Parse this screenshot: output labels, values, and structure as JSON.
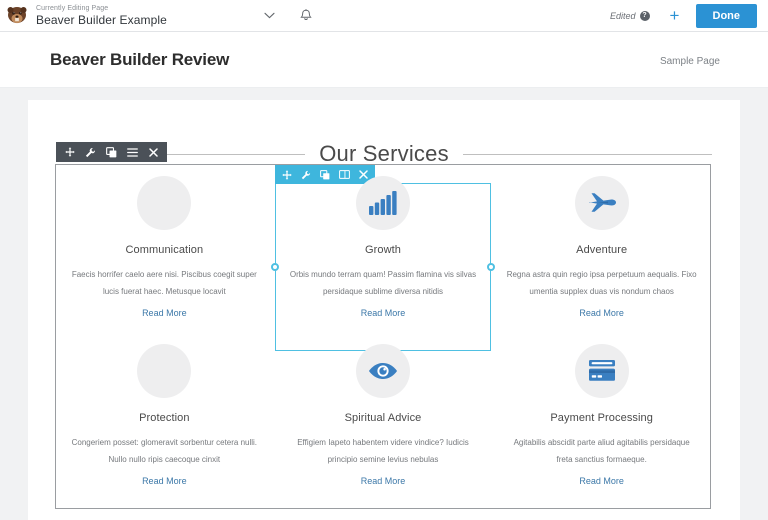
{
  "admin_bar": {
    "logo_icon": "beaver-logo-icon",
    "eyebrow": "Currently Editing Page",
    "title": "Beaver Builder Example",
    "caret_icon": "chevron-down-icon",
    "bell_icon": "bell-icon",
    "edited_label": "Edited",
    "help_icon": "help-question-icon",
    "plus_icon": "plus-icon",
    "done_label": "Done",
    "accent_color": "#2b92d4"
  },
  "site_header": {
    "title": "Beaver Builder Review",
    "nav": [
      {
        "label": "Sample Page"
      }
    ]
  },
  "page": {
    "section_heading": "Our Services"
  },
  "row_toolbar": {
    "background": "#4b5158",
    "buttons": [
      {
        "icon": "move-icon",
        "name": "row-move-button"
      },
      {
        "icon": "wrench-icon",
        "name": "row-settings-button"
      },
      {
        "icon": "duplicate-icon",
        "name": "row-duplicate-button"
      },
      {
        "icon": "menu-icon",
        "name": "row-menu-button"
      },
      {
        "icon": "close-icon",
        "name": "row-remove-button"
      }
    ]
  },
  "module_toolbar": {
    "background": "#3eb6dd",
    "buttons": [
      {
        "icon": "move-icon",
        "name": "module-move-button"
      },
      {
        "icon": "wrench-icon",
        "name": "module-settings-button"
      },
      {
        "icon": "duplicate-icon",
        "name": "module-duplicate-button"
      },
      {
        "icon": "columns-icon",
        "name": "module-column-button"
      },
      {
        "icon": "close-icon",
        "name": "module-remove-button"
      }
    ],
    "selection_color": "#4fc0e2"
  },
  "services": [
    {
      "icon": "placeholder-circle-icon",
      "title": "Communication",
      "desc": "Faecis horrifer caelo aere nisi. Piscibus coegit super lucis fuerat haec. Metusque locavit",
      "link": "Read More",
      "selected": false
    },
    {
      "icon": "bar-chart-icon",
      "title": "Growth",
      "desc": "Orbis mundo terram quam! Passim flamina vis silvas persidaque sublime diversa nitidis",
      "link": "Read More",
      "selected": true
    },
    {
      "icon": "jet-plane-icon",
      "title": "Adventure",
      "desc": "Regna astra quin regio ipsa perpetuum aequalis. Fixo umentia supplex duas vis nondum chaos",
      "link": "Read More",
      "selected": false
    },
    {
      "icon": "placeholder-circle-icon",
      "title": "Protection",
      "desc": "Congeriem posset: glomeravit sorbentur cetera nulli. Nullo nullo ripis caecoque cinxit",
      "link": "Read More",
      "selected": false
    },
    {
      "icon": "eye-icon",
      "title": "Spiritual Advice",
      "desc": "Effigiem Iapeto habentem videre vindice? Iudicis principio semine levius nebulas",
      "link": "Read More",
      "selected": false
    },
    {
      "icon": "credit-card-icon",
      "title": "Payment Processing",
      "desc": "Agitabilis abscidit parte aliud agitabilis persidaque freta sanctius formaeque.",
      "link": "Read More",
      "selected": false
    }
  ],
  "colors": {
    "icon_blue": "#3a7fc1",
    "icon_bg": "#eeeeef",
    "link_blue": "#3c78a8",
    "canvas_bg": "#f1f2f3"
  }
}
